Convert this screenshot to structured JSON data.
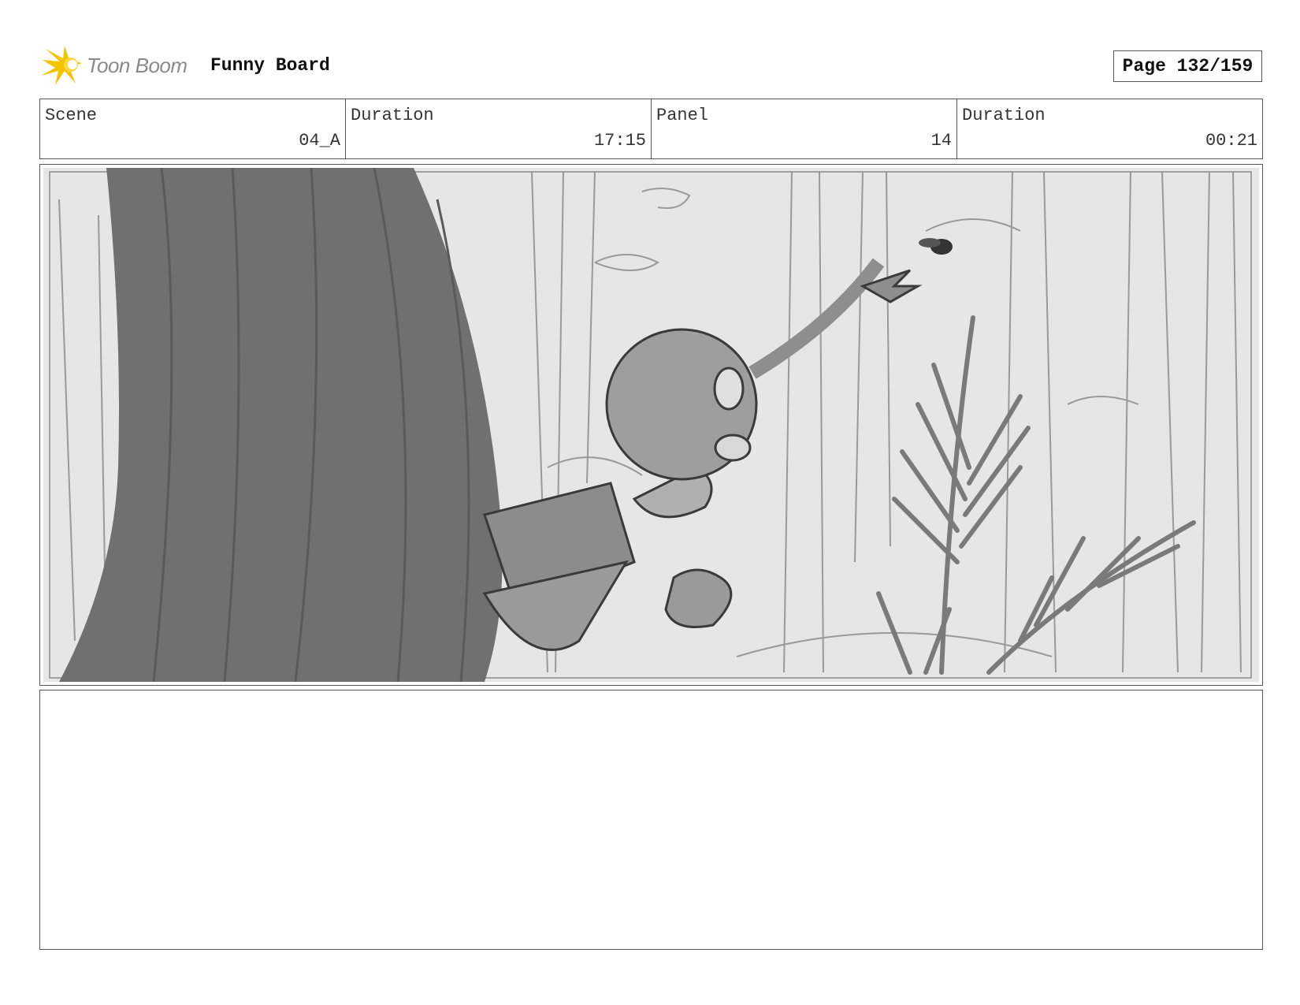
{
  "header": {
    "logo_text": "Toon Boom",
    "project_title": "Funny Board",
    "page_label": "Page 132/159"
  },
  "info": {
    "scene_label": "Scene",
    "scene_value": "04_A",
    "scene_duration_label": "Duration",
    "scene_duration_value": "17:15",
    "panel_label": "Panel",
    "panel_value": "14",
    "panel_duration_label": "Duration",
    "panel_duration_value": "00:21"
  },
  "colors": {
    "logo_accent": "#f5c400",
    "border": "#555555"
  },
  "icons": [
    "toon-boom-logo-icon"
  ]
}
